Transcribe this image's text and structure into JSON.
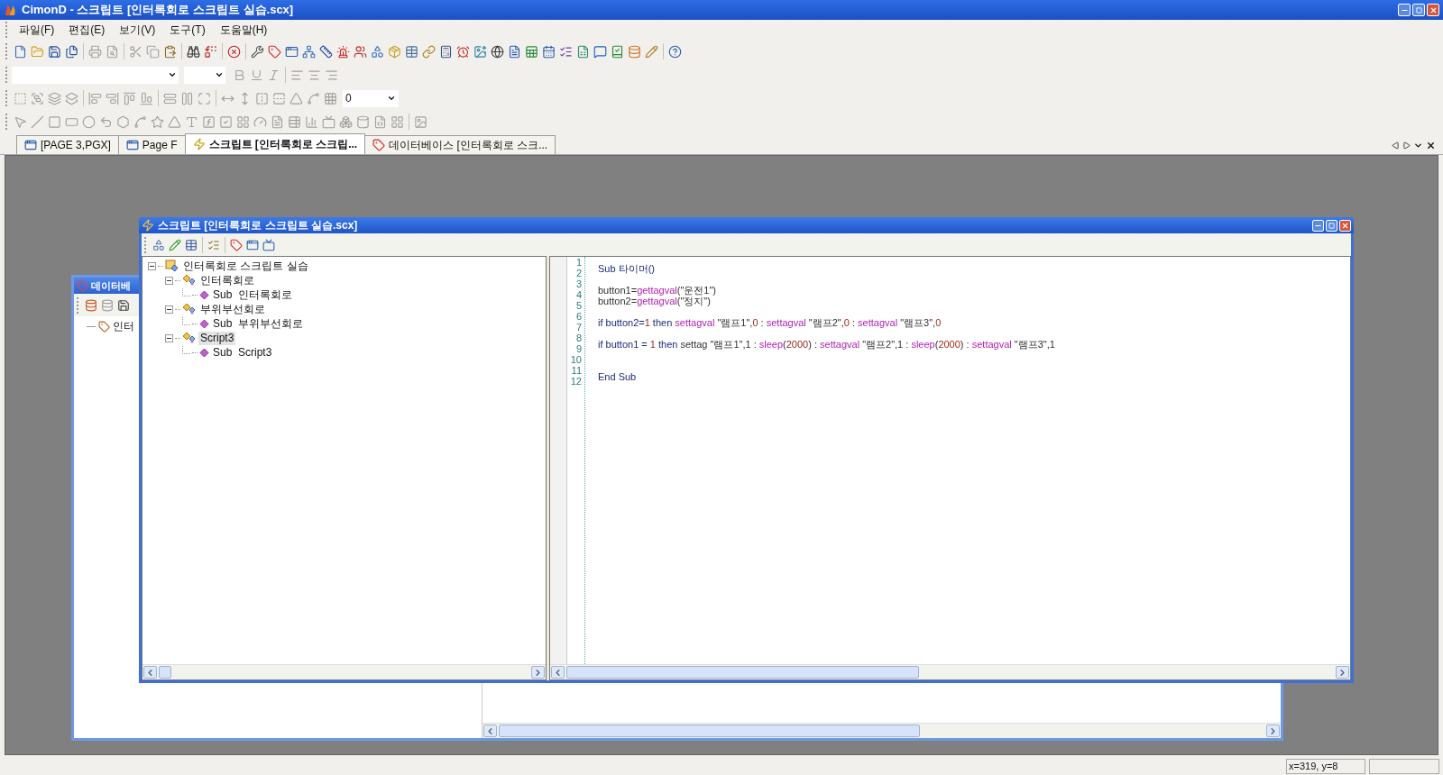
{
  "window": {
    "title": "CimonD - 스크립트 [인터록회로 스크립트 실습.scx]"
  },
  "menu": [
    "파일(F)",
    "편집(E)",
    "보기(V)",
    "도구(T)",
    "도움말(H)"
  ],
  "toolbar_combo": {
    "value": "0"
  },
  "tabs": [
    {
      "label": "[PAGE 3,PGX]",
      "selected": false,
      "kind": "page"
    },
    {
      "label": "Page F",
      "selected": false,
      "kind": "page"
    },
    {
      "label": "스크립트 [인터록회로 스크립...",
      "selected": true,
      "kind": "script"
    },
    {
      "label": "데이터베이스 [인터록회로 스크...",
      "selected": false,
      "kind": "database"
    }
  ],
  "database_window": {
    "title": "데이터베",
    "tree": [
      {
        "label": "인터"
      }
    ]
  },
  "script_window": {
    "title": "스크립트 [인터록회로 스크립트 실습.scx]",
    "tree": [
      {
        "label": "인터록회로 스크립트 실습",
        "kind": "root",
        "expanded": true,
        "selected": false,
        "children": [
          {
            "label": "인터록회로",
            "kind": "module",
            "expanded": true,
            "selected": false,
            "children": [
              {
                "label": "Sub  인터록회로",
                "kind": "sub",
                "selected": false
              }
            ]
          },
          {
            "label": "부위부선회로",
            "kind": "module",
            "expanded": true,
            "selected": false,
            "children": [
              {
                "label": "Sub  부위부선회로",
                "kind": "sub",
                "selected": false
              }
            ]
          },
          {
            "label": "Script3",
            "kind": "module",
            "expanded": true,
            "selected": true,
            "children": [
              {
                "label": "Sub  Script3",
                "kind": "sub",
                "selected": false
              }
            ]
          }
        ]
      }
    ],
    "code": [
      {
        "number": "1",
        "tokens": [
          {
            "kind": "keyword",
            "text": "Sub 타이머()"
          }
        ]
      },
      {
        "number": "2"
      },
      {
        "number": "3",
        "tokens": [
          {
            "kind": "plain",
            "text": "button1="
          },
          {
            "kind": "function",
            "text": "gettagval"
          },
          {
            "kind": "plain",
            "text": "(\"운전1\")"
          }
        ]
      },
      {
        "number": "4",
        "tokens": [
          {
            "kind": "plain",
            "text": "button2="
          },
          {
            "kind": "function",
            "text": "gettagval"
          },
          {
            "kind": "plain",
            "text": "(\"정지\")"
          }
        ]
      },
      {
        "number": "5"
      },
      {
        "number": "6",
        "tokens": [
          {
            "kind": "keyword",
            "text": "if button2="
          },
          {
            "kind": "number",
            "text": "1"
          },
          {
            "kind": "keyword",
            "text": " then "
          },
          {
            "kind": "function",
            "text": "settagval"
          },
          {
            "kind": "plain",
            "text": " \"램프1\","
          },
          {
            "kind": "number",
            "text": "0"
          },
          {
            "kind": "plain",
            "text": " : "
          },
          {
            "kind": "function",
            "text": "settagval"
          },
          {
            "kind": "plain",
            "text": " \"램프2\","
          },
          {
            "kind": "number",
            "text": "0"
          },
          {
            "kind": "plain",
            "text": " : "
          },
          {
            "kind": "function",
            "text": "settagval"
          },
          {
            "kind": "plain",
            "text": " \"램프3\","
          },
          {
            "kind": "number",
            "text": "0"
          }
        ]
      },
      {
        "number": "7"
      },
      {
        "number": "8",
        "tokens": [
          {
            "kind": "keyword",
            "text": "if button1 = "
          },
          {
            "kind": "number",
            "text": "1"
          },
          {
            "kind": "keyword",
            "text": " then "
          },
          {
            "kind": "plain",
            "text": "settag \"램프1\",1 : "
          },
          {
            "kind": "function",
            "text": "sleep"
          },
          {
            "kind": "plain",
            "text": "("
          },
          {
            "kind": "number",
            "text": "2000"
          },
          {
            "kind": "plain",
            "text": ") : "
          },
          {
            "kind": "function",
            "text": "settagval"
          },
          {
            "kind": "plain",
            "text": " \"램프2\",1 : "
          },
          {
            "kind": "function",
            "text": "sleep"
          },
          {
            "kind": "plain",
            "text": "("
          },
          {
            "kind": "number",
            "text": "2000"
          },
          {
            "kind": "plain",
            "text": ") : "
          },
          {
            "kind": "function",
            "text": "settagval"
          },
          {
            "kind": "plain",
            "text": " \"램프3\",1"
          }
        ]
      },
      {
        "number": "9"
      },
      {
        "number": "10"
      },
      {
        "number": "11",
        "tokens": [
          {
            "kind": "keyword",
            "text": "End Sub"
          }
        ]
      },
      {
        "number": "12"
      }
    ]
  },
  "status_bar": {
    "position": "x=319, y=8"
  }
}
